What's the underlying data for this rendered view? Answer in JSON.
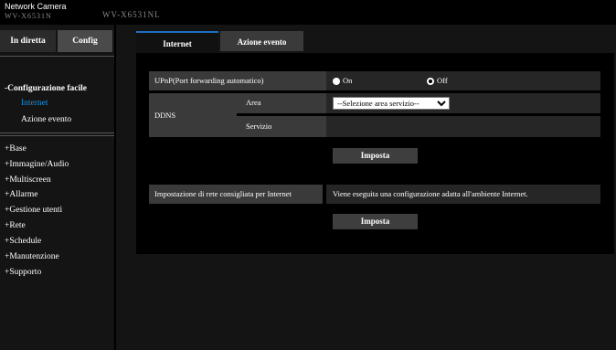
{
  "header": {
    "brand": "Network Camera",
    "brand_model": "WV-X6531N",
    "camera_model": "WV-X6531NL"
  },
  "topnav": {
    "live_label": "In diretta",
    "config_label": "Config"
  },
  "sidebar": {
    "quick_setup": "-Configurazione facile",
    "sub_items": [
      "Internet",
      "Azione evento"
    ],
    "items": [
      "+Base",
      "+Immagine/Audio",
      "+Multiscreen",
      "+Allarme",
      "+Gestione utenti",
      "+Rete",
      "+Schedule",
      "+Manutenzione",
      "+Supporto"
    ]
  },
  "tabs": {
    "internet": "Internet",
    "evento": "Azione evento"
  },
  "upnp": {
    "label": "UPnP(Port forwarding automatico)",
    "on_label": "On",
    "off_label": "Off",
    "selected": "Off"
  },
  "ddns": {
    "label": "DDNS",
    "area_label": "Area",
    "area_value": "--Selezione area servizio--",
    "servizio_label": "Servizio",
    "servizio_value": ""
  },
  "buttons": {
    "imposta1": "Imposta",
    "imposta2": "Imposta"
  },
  "network": {
    "label": "Impostazione di rete consigliata per Internet",
    "description": "Viene eseguita una configurazione adatta all'ambiente Internet."
  }
}
